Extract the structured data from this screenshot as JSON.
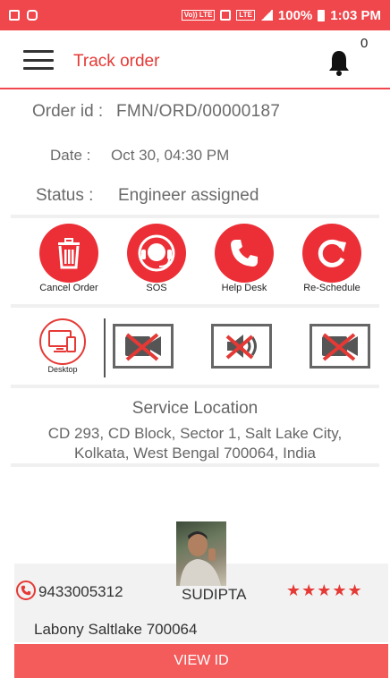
{
  "status_bar": {
    "network_tags": [
      "Vo)) LTE",
      "LTE"
    ],
    "battery_percent": "100%",
    "time": "1:03 PM"
  },
  "app_bar": {
    "title": "Track order",
    "notification_count": "0"
  },
  "order": {
    "id_label": "Order id :",
    "id_value": "FMN/ORD/00000187",
    "date_label": "Date :",
    "date_value": "Oct 30, 04:30 PM",
    "status_label": "Status :",
    "status_value": "Engineer assigned"
  },
  "actions": [
    {
      "label": "Cancel Order",
      "icon": "trash-icon"
    },
    {
      "label": "SOS",
      "icon": "headset-icon"
    },
    {
      "label": "Help Desk",
      "icon": "phone-icon"
    },
    {
      "label": "Re-Schedule",
      "icon": "refresh-icon"
    }
  ],
  "video_call": {
    "desktop_label": "Desktop",
    "toggles": [
      "video-off-icon",
      "speaker-off-icon",
      "video-off-icon"
    ]
  },
  "service_location": {
    "title": "Service Location",
    "address_line1": "CD 293, CD Block, Sector 1, Salt Lake City,",
    "address_line2": "Kolkata, West Bengal 700064, India"
  },
  "engineer": {
    "phone": "9433005312",
    "name": "SUDIPTA",
    "rating": 5,
    "stars": "★★★★★",
    "address": "Labony Saltlake 700064"
  },
  "view_id_label": "VIEW ID",
  "colors": {
    "accent": "#ec2f36",
    "status_bar": "#f0474c",
    "view_button": "#f45b5b"
  }
}
